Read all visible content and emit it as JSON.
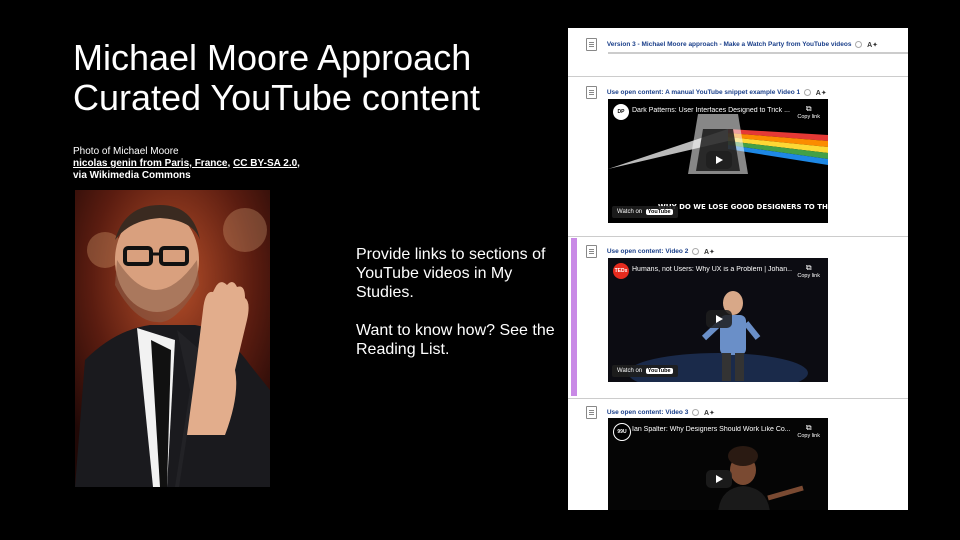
{
  "slide": {
    "title_line1": "Michael Moore Approach",
    "title_line2": "Curated YouTube content",
    "credit": {
      "line1": "Photo of Michael Moore",
      "link1": "nicolas genin from Paris, France",
      "sep1": ", ",
      "link2": "CC BY-SA 2.0",
      "tail": ", via Wikimedia Commons"
    },
    "body_paragraph1": "Provide links to sections of YouTube videos in My Studies.",
    "body_paragraph2": "Want to know how? See the Reading List."
  },
  "panel": {
    "top_item": "Version 3 - Michael Moore approach - Make a Watch Party from YouTube videos",
    "ai_label": "A✦",
    "copy_label": "Copy link",
    "copy_glyph": "⧉",
    "watch_label": "Watch on",
    "youtube_label": "YouTube",
    "items": [
      {
        "heading": "Use open content: A manual YouTube snippet example Video 1",
        "video_title": "Dark Patterns: User Interfaces Designed to Trick ...",
        "channel": "DP",
        "caption": "WHY DO WE LOSE GOOD DESIGNERS TO THE DARK SIDE?"
      },
      {
        "heading": "Use open content: Video 2",
        "video_title": "Humans, not Users: Why UX is a Problem | Johan...",
        "channel": "TEDx",
        "caption": ""
      },
      {
        "heading": "Use open content: Video 3",
        "video_title": "Ian Spalter: Why Designers Should Work Like Co...",
        "channel": "99U",
        "caption": ""
      }
    ]
  },
  "colors": {
    "background": "#000000",
    "panel_link": "#1a3f8a",
    "accent": "#c98ae6"
  }
}
